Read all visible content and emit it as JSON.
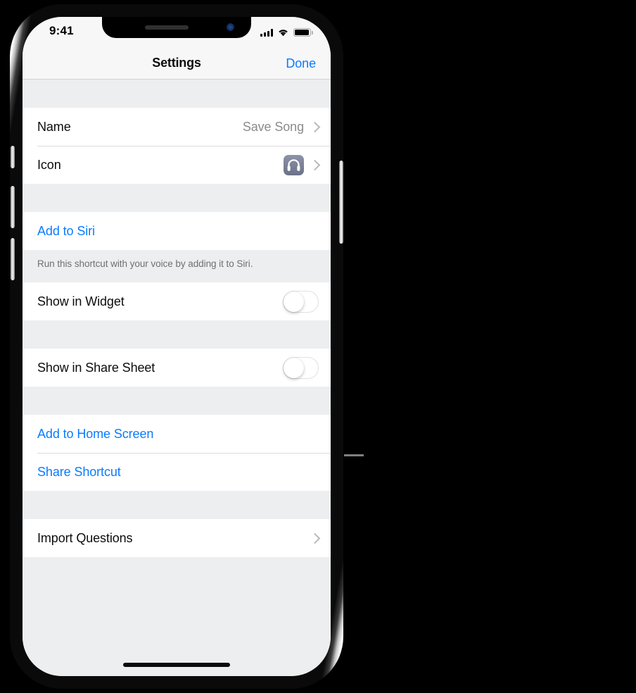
{
  "status_bar": {
    "time": "9:41",
    "cellular_icon": "signal-bars-icon",
    "wifi_icon": "wifi-icon",
    "battery_icon": "battery-icon"
  },
  "nav_bar": {
    "title": "Settings",
    "done_label": "Done"
  },
  "colors": {
    "accent_blue": "#0a7bff",
    "value_gray": "#8b8b90",
    "group_background": "#ffffff",
    "page_background": "#eceef0",
    "separator": "#dcdcde",
    "icon_tile": "#7a8095"
  },
  "sections": [
    {
      "name": "details",
      "rows": [
        {
          "label": "Name",
          "value": "Save Song",
          "accessory": "chevron-right-icon",
          "type": "disclosure"
        },
        {
          "label": "Icon",
          "value": "",
          "accessory": "chevron-right-icon",
          "type": "icon-disclosure",
          "icon": "headphones-icon"
        }
      ]
    },
    {
      "name": "siri",
      "rows": [
        {
          "label": "Add to Siri",
          "type": "action-blue"
        }
      ],
      "footer": "Run this shortcut with your voice by adding it to Siri."
    },
    {
      "name": "widget",
      "rows": [
        {
          "label": "Show in Widget",
          "type": "toggle",
          "toggle_on": false
        }
      ]
    },
    {
      "name": "share-sheet",
      "rows": [
        {
          "label": "Show in Share Sheet",
          "type": "toggle",
          "toggle_on": false
        }
      ]
    },
    {
      "name": "actions",
      "rows": [
        {
          "label": "Add to Home Screen",
          "type": "action-blue"
        },
        {
          "label": "Share Shortcut",
          "type": "action-blue"
        }
      ]
    },
    {
      "name": "import",
      "rows": [
        {
          "label": "Import Questions",
          "accessory": "chevron-right-icon",
          "type": "disclosure"
        }
      ]
    }
  ],
  "device": {
    "home_indicator": "home-indicator",
    "notch_camera": "front-camera-icon",
    "notch_speaker": "earpiece-speaker"
  }
}
